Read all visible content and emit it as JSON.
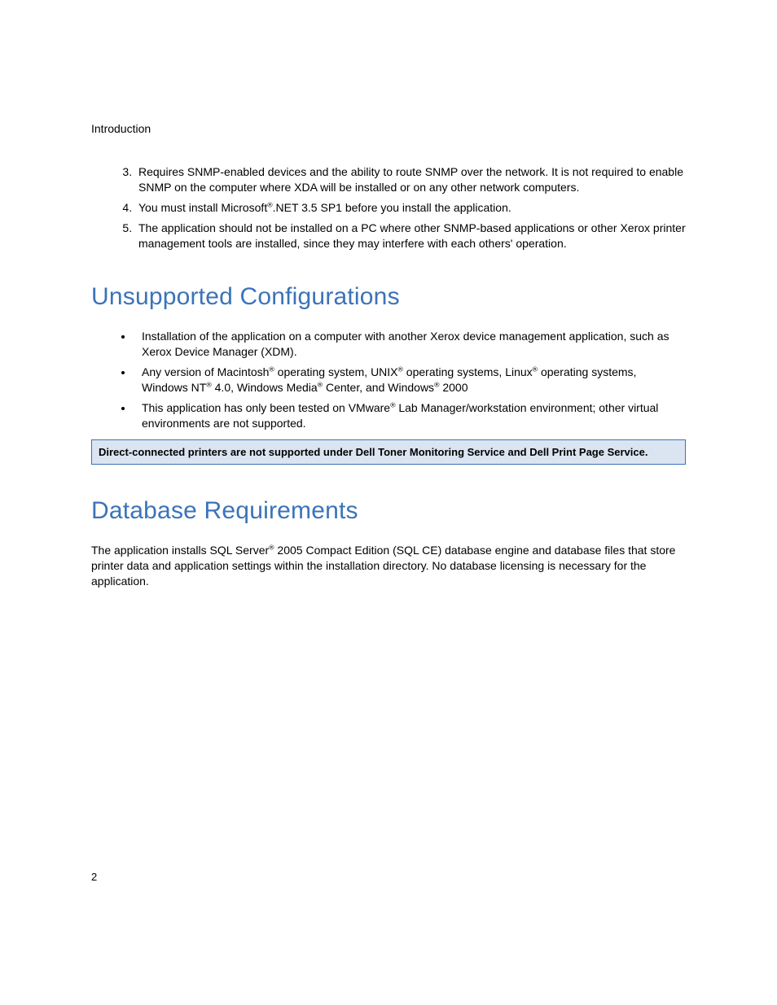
{
  "header": {
    "section": "Introduction"
  },
  "ordered": {
    "start": 3,
    "items": [
      {
        "pre": "Requires SNMP-enabled devices and the ability to route SNMP over the network. It is not required to enable SNMP on the computer where XDA will be installed or on any other network computers."
      },
      {
        "pre": "You must install Microsoft",
        "sup1": "®",
        "post": ".NET 3.5 SP1 before you install the application."
      },
      {
        "pre": "The application should not be installed on a PC where other SNMP-based applications or other Xerox printer management tools are installed, since they may interfere with each others' operation."
      }
    ]
  },
  "heading1": "Unsupported Configurations",
  "bullets": [
    {
      "pre": "Installation of the application on a computer with another Xerox device management application, such as Xerox Device Manager (XDM)."
    },
    {
      "pre": "Any version of Macintosh",
      "sup1": "®",
      "mid1": " operating system, UNIX",
      "sup2": "®",
      "mid2": " operating systems, Linux",
      "sup3": "®",
      "mid3": " operating systems, Windows NT",
      "sup4": "®",
      "mid4": " 4.0, Windows Media",
      "sup5": "®",
      "mid5": " Center, and Windows",
      "sup6": "®",
      "post": " 2000"
    },
    {
      "pre": "This application has only been tested on VMware",
      "sup1": "®",
      "post": " Lab Manager/workstation environment; other virtual environments are not supported."
    }
  ],
  "note": "Direct-connected printers are not supported under Dell Toner Monitoring Service and Dell Print Page Service.",
  "heading2": "Database Requirements",
  "para2": {
    "pre": "The application installs SQL Server",
    "sup1": "®",
    "post": " 2005 Compact Edition (SQL CE) database engine and database files that store printer data and application settings within the installation directory. No database licensing is necessary for the application."
  },
  "page_number": "2"
}
